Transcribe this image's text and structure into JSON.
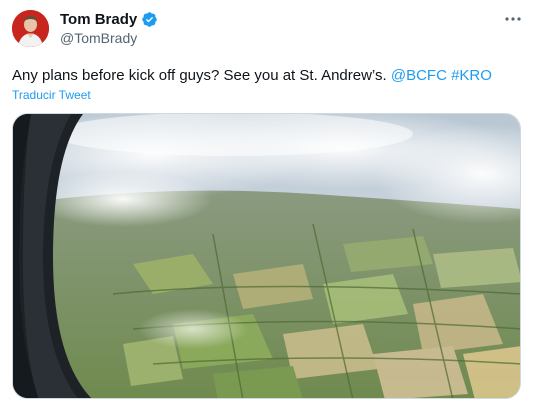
{
  "tweet": {
    "display_name": "Tom Brady",
    "handle": "@TomBrady",
    "text_plain": "Any plans before kick off guys? See you at St. Andrew’s. ",
    "mention": "@BCFC",
    "hashtag": "#KRO",
    "translate_label": "Traducir Tweet",
    "verified": true
  },
  "icons": {
    "verified": "verified-badge-icon",
    "more": "more-options-icon"
  },
  "colors": {
    "link": "#1d9bf0",
    "verified": "#1d9bf0",
    "secondary_text": "#536471",
    "avatar_bg": "#c8251f"
  },
  "media": {
    "description_visible": false
  }
}
